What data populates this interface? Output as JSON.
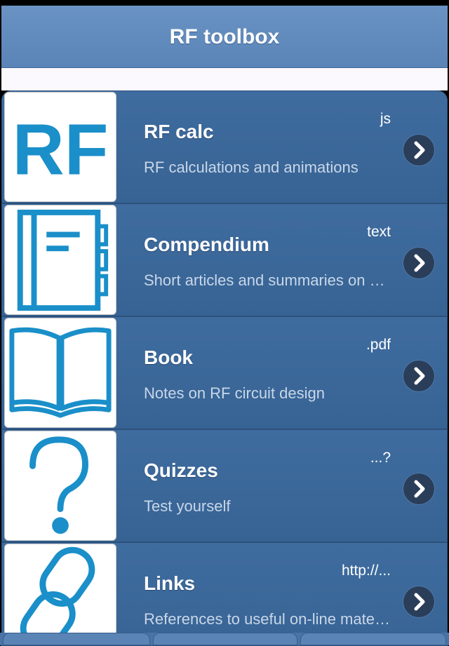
{
  "header": {
    "title": "RF toolbox"
  },
  "items": [
    {
      "title": "RF calc",
      "description": "RF calculations and animations",
      "tag": "js",
      "icon": "rf-logo-icon"
    },
    {
      "title": "Compendium",
      "description": "Short articles and summaries on RF topics",
      "tag": "text",
      "icon": "notebook-icon"
    },
    {
      "title": "Book",
      "description": "Notes on RF circuit design",
      "tag": ".pdf",
      "icon": "open-book-icon"
    },
    {
      "title": "Quizzes",
      "description": "Test yourself",
      "tag": "...?",
      "icon": "question-mark-icon"
    },
    {
      "title": "Links",
      "description": "References to useful on-line material",
      "tag": "http://...",
      "icon": "link-chain-icon"
    }
  ],
  "colors": {
    "accent": "#1a8fc9",
    "header": "#5a84b7",
    "list": "#3a6698"
  }
}
